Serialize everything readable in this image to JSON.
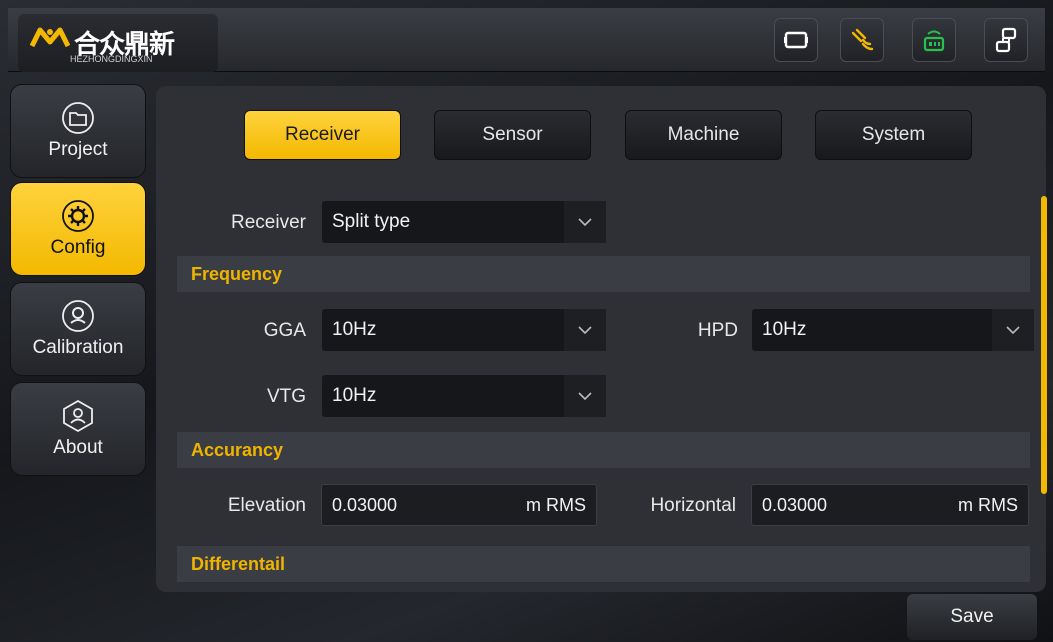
{
  "brand": {
    "name_cn": "合众鼎新",
    "name_en": "HEZHONGDINGXIN"
  },
  "status_icons": [
    "screen-frame-icon",
    "satellite-icon",
    "radio-icon",
    "network-icon"
  ],
  "sidebar": {
    "items": [
      {
        "label": "Project",
        "icon": "folder-icon",
        "active": false
      },
      {
        "label": "Config",
        "icon": "gear-icon",
        "active": true
      },
      {
        "label": "Calibration",
        "icon": "calibration-icon",
        "active": false
      },
      {
        "label": "About",
        "icon": "info-icon",
        "active": false
      }
    ]
  },
  "tabs": [
    {
      "label": "Receiver",
      "active": true
    },
    {
      "label": "Sensor",
      "active": false
    },
    {
      "label": "Machine",
      "active": false
    },
    {
      "label": "System",
      "active": false
    }
  ],
  "receiver": {
    "label": "Receiver",
    "value": "Split type"
  },
  "sections": {
    "frequency": "Frequency",
    "accuracy": "Accurancy",
    "differential": "Differentail"
  },
  "frequency": {
    "gga": {
      "label": "GGA",
      "value": "10Hz"
    },
    "hpd": {
      "label": "HPD",
      "value": "10Hz"
    },
    "vtg": {
      "label": "VTG",
      "value": "10Hz"
    }
  },
  "accuracy": {
    "elevation": {
      "label": "Elevation",
      "value": "0.03000",
      "unit": "m RMS"
    },
    "horizontal": {
      "label": "Horizontal",
      "value": "0.03000",
      "unit": "m RMS"
    }
  },
  "actions": {
    "save": "Save"
  },
  "colors": {
    "accent": "#f3b800",
    "panel": "#2e3035",
    "field": "#15171a"
  }
}
